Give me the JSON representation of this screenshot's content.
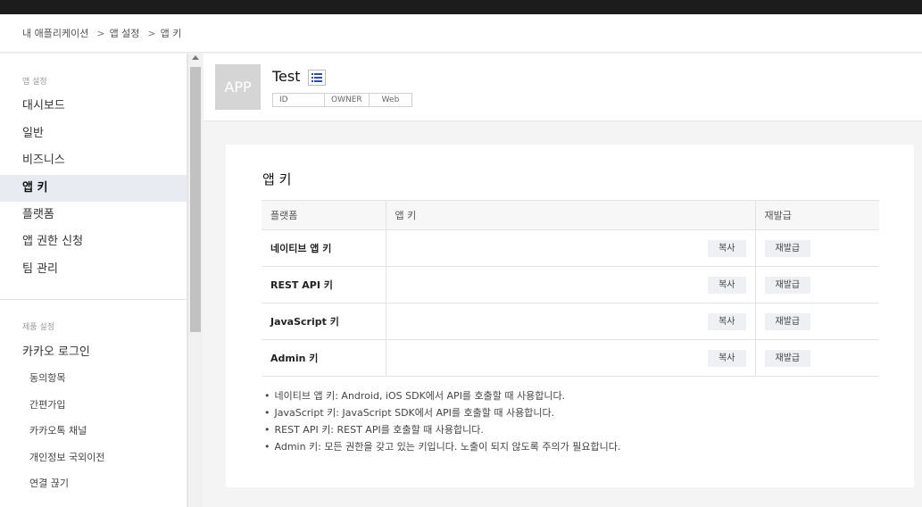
{
  "breadcrumb": [
    "내 애플리케이션",
    "앱 설정",
    "앱 키"
  ],
  "sidebar": {
    "section1_title": "앱 설정",
    "items": [
      {
        "label": "대시보드"
      },
      {
        "label": "일반"
      },
      {
        "label": "비즈니스"
      },
      {
        "label": "앱 키"
      },
      {
        "label": "플랫폼"
      },
      {
        "label": "앱 권한 신청"
      },
      {
        "label": "팀 관리"
      }
    ],
    "section2_title": "제품 설정",
    "product": {
      "label": "카카오 로그인"
    },
    "sub_items": [
      {
        "label": "동의항목"
      },
      {
        "label": "간편가입"
      },
      {
        "label": "카카오톡 채널"
      },
      {
        "label": "개인정보 국외이전"
      },
      {
        "label": "연결 끊기"
      }
    ]
  },
  "app": {
    "thumb_text": "APP",
    "name": "Test",
    "tags": [
      "ID",
      "OWNER",
      "Web"
    ]
  },
  "card": {
    "title": "앱 키",
    "columns": [
      "플랫폼",
      "앱 키",
      "재발급"
    ],
    "rows": [
      {
        "platform": "네이티브 앱 키",
        "copy": "복사",
        "reissue": "재발급"
      },
      {
        "platform": "REST API 키",
        "copy": "복사",
        "reissue": "재발급"
      },
      {
        "platform": "JavaScript 키",
        "copy": "복사",
        "reissue": "재발급"
      },
      {
        "platform": "Admin 키",
        "copy": "복사",
        "reissue": "재발급"
      }
    ],
    "notes": [
      "네이티브 앱 키: Android, iOS SDK에서 API를 호출할 때 사용합니다.",
      "JavaScript 키: JavaScript SDK에서 API를 호출할 때 사용합니다.",
      "REST API 키: REST API를 호출할 때 사용합니다.",
      "Admin 키: 모든 권한을 갖고 있는 키입니다. 노출이 되지 않도록 주의가 필요합니다."
    ]
  },
  "colors": {
    "active_bg": "#e8ebf2",
    "topbar": "#1c1c1c"
  }
}
